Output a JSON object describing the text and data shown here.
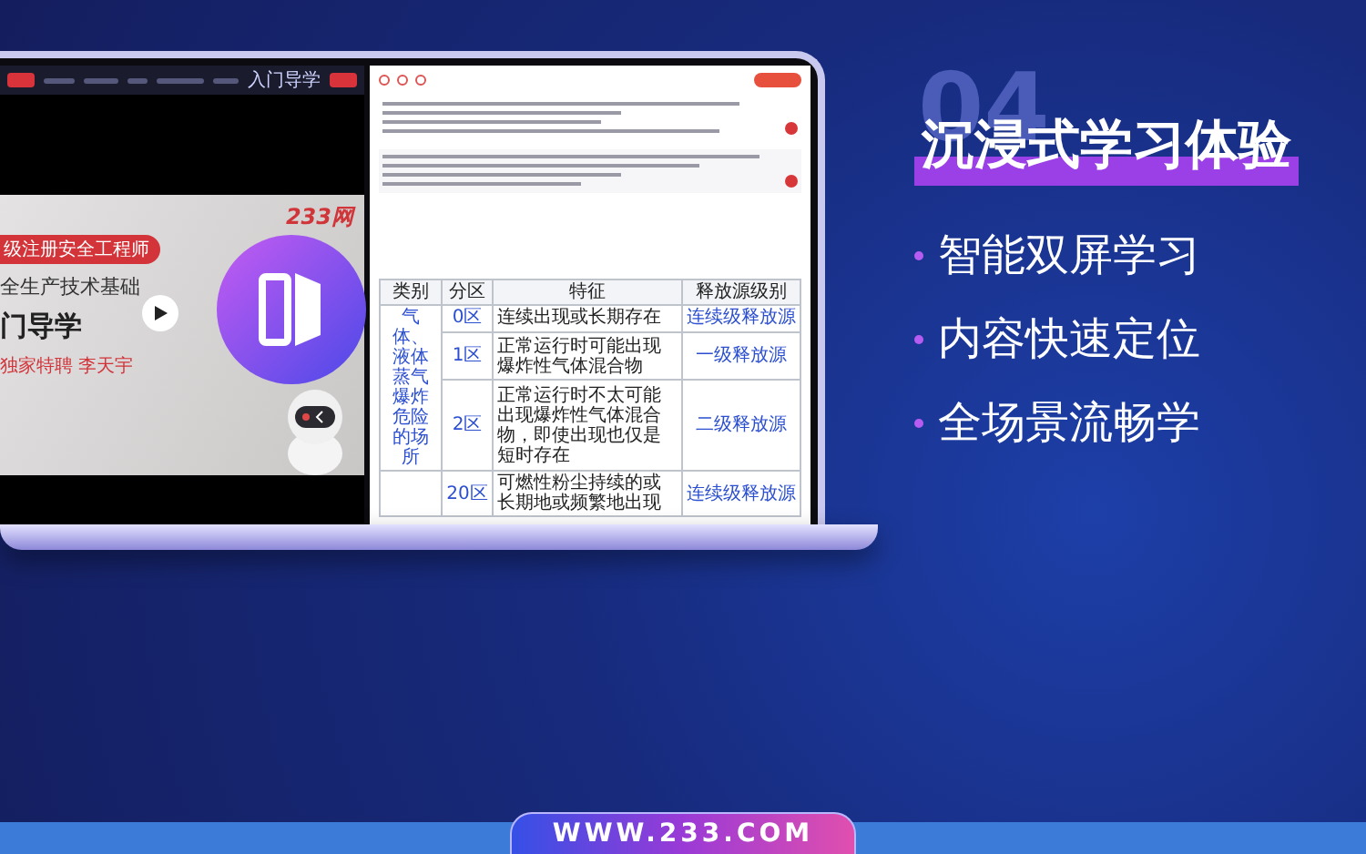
{
  "video": {
    "top_tab": "入门导学",
    "badge": "级注册安全工程师",
    "subtitle": "全生产技术基础",
    "title": "门导学",
    "lecturer": "独家特聘  李天宇",
    "brand": "233网"
  },
  "document": {
    "table": {
      "columns": [
        "类别",
        "分区",
        "特征",
        "释放源级别"
      ],
      "groups": [
        {
          "category": "气体、液体蒸气爆炸危险的场所",
          "rows": [
            {
              "zone": "0区",
              "feature": "连续出现或长期存在",
              "level": "连续级释放源"
            },
            {
              "zone": "1区",
              "feature": "正常运行时可能出现爆炸性气体混合物",
              "level": "一级释放源"
            },
            {
              "zone": "2区",
              "feature": "正常运行时不太可能出现爆炸性气体混合物，即使出现也仅是短时存在",
              "level": "二级释放源"
            }
          ]
        },
        {
          "rows": [
            {
              "zone": "20区",
              "feature": "可燃性粉尘持续的或长期地或频繁地出现",
              "level": "连续级释放源"
            }
          ]
        }
      ]
    }
  },
  "headline": {
    "number": "04",
    "title": "沉浸式学习体验"
  },
  "features": [
    "智能双屏学习",
    "内容快速定位",
    "全场景流畅学"
  ],
  "footer": {
    "url": "WWW.233.COM"
  }
}
